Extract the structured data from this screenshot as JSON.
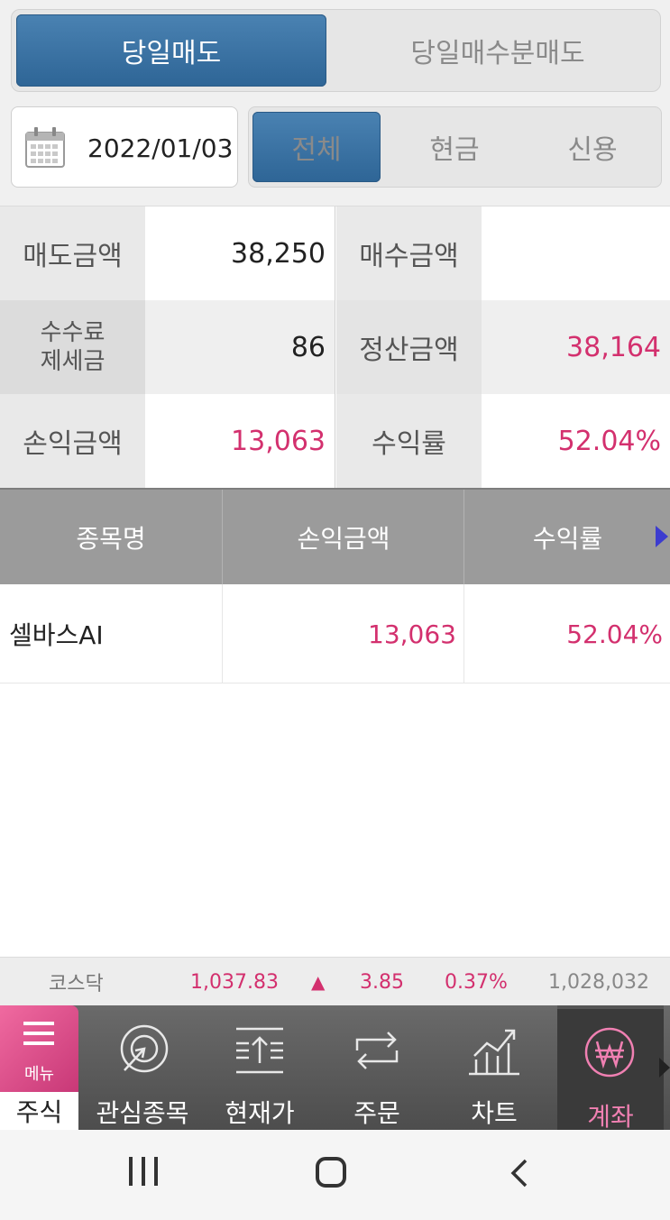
{
  "tabs_top": {
    "left": "당일매도",
    "right": "당일매수분매도",
    "active": "left"
  },
  "date": "2022/01/03",
  "filter_tabs": [
    "전체",
    "현금",
    "신용"
  ],
  "summary": {
    "sell_amount_label": "매도금액",
    "sell_amount": "38,250",
    "buy_amount_label": "매수금액",
    "buy_amount": "",
    "fee_label_1": "수수료",
    "fee_label_2": "제세금",
    "fee": "86",
    "settle_label": "정산금액",
    "settle": "38,164",
    "pl_label": "손익금액",
    "pl": "13,063",
    "rate_label": "수익률",
    "rate": "52.04%"
  },
  "table": {
    "headers": [
      "종목명",
      "손익금액",
      "수익률"
    ],
    "rows": [
      {
        "name": "셀바스AI",
        "pl": "13,063",
        "rate": "52.04%"
      }
    ]
  },
  "ticker": {
    "name": "코스닥",
    "value": "1,037.83",
    "arrow": "▲",
    "change": "3.85",
    "percent": "0.37%",
    "volume": "1,028,032"
  },
  "tabbar": {
    "menu": "메뉴",
    "stock": "주식",
    "items": [
      "관심종목",
      "현재가",
      "주문",
      "차트",
      "계좌"
    ]
  },
  "colors": {
    "accent": "#2e6596",
    "positive": "#d3306e",
    "brand": "#e0508e"
  }
}
